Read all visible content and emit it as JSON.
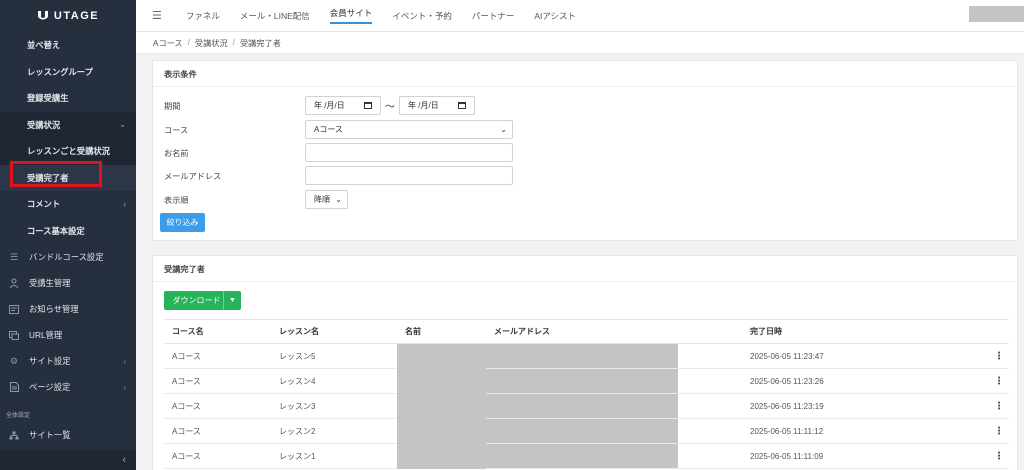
{
  "app": {
    "logo_text": "UTAGE"
  },
  "sidebar": {
    "sub_items": [
      {
        "label": "並べ替え"
      },
      {
        "label": "レッスングループ"
      },
      {
        "label": "登録受講生"
      },
      {
        "label": "受講状況"
      },
      {
        "label": "レッスンごと受講状況"
      },
      {
        "label": "受講完了者"
      },
      {
        "label": "コメント"
      },
      {
        "label": "コース基本設定"
      }
    ],
    "main_items": [
      {
        "label": "バンドルコース設定",
        "icon": "list-icon"
      },
      {
        "label": "受講生管理",
        "icon": "user-icon"
      },
      {
        "label": "お知らせ管理",
        "icon": "news-icon"
      },
      {
        "label": "URL管理",
        "icon": "link-icon"
      },
      {
        "label": "サイト設定",
        "icon": "gear-icon"
      },
      {
        "label": "ページ設定",
        "icon": "page-icon"
      }
    ],
    "section_label": "全体設定",
    "bottom_item": {
      "label": "サイト一覧",
      "icon": "sitemap-icon"
    },
    "collapse_glyph": "‹"
  },
  "topnav": {
    "tabs": [
      {
        "label": "ファネル"
      },
      {
        "label": "メール・LINE配信"
      },
      {
        "label": "会員サイト"
      },
      {
        "label": "イベント・予約"
      },
      {
        "label": "パートナー"
      },
      {
        "label": "AIアシスト"
      }
    ],
    "active_index": 2
  },
  "breadcrumb": [
    "Aコース",
    "受講状況",
    "受講完了者"
  ],
  "filter": {
    "title": "表示条件",
    "period_label": "期間",
    "date_from": "年 /月/日",
    "date_to": "年 /月/日",
    "tilde": "〜",
    "course_label": "コース",
    "course_value": "Aコース",
    "name_label": "お名前",
    "email_label": "メールアドレス",
    "order_label": "表示順",
    "order_value": "降順",
    "submit_label": "絞り込み"
  },
  "results": {
    "title": "受講完了者",
    "download_label": "ダウンロード",
    "columns": [
      "コース名",
      "レッスン名",
      "名前",
      "メールアドレス",
      "完了日時"
    ],
    "rows": [
      {
        "course": "Aコース",
        "lesson": "レッスン5",
        "completed": "2025-06-05 11:23:47"
      },
      {
        "course": "Aコース",
        "lesson": "レッスン4",
        "completed": "2025-06-05 11:23:26"
      },
      {
        "course": "Aコース",
        "lesson": "レッスン3",
        "completed": "2025-06-05 11:23:19"
      },
      {
        "course": "Aコース",
        "lesson": "レッスン2",
        "completed": "2025-06-05 11:11:12"
      },
      {
        "course": "Aコース",
        "lesson": "レッスン1",
        "completed": "2025-06-05 11:11:09"
      }
    ],
    "kebab": "⋮"
  },
  "colors": {
    "sidebar_bg": "#262f3e",
    "primary": "#3c9eea",
    "success": "#27b35a",
    "highlight": "#e0141f"
  }
}
